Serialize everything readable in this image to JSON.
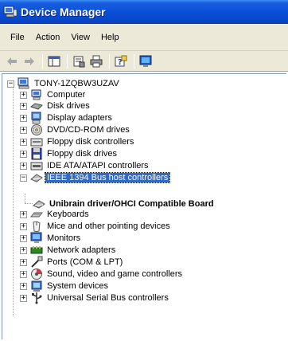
{
  "window": {
    "title": "Device Manager",
    "title_icon": "device-manager-icon"
  },
  "menu": [
    "File",
    "Action",
    "View",
    "Help"
  ],
  "toolbar": {
    "buttons": [
      "back-arrow-icon",
      "forward-arrow-icon",
      "show-hide-tree-icon",
      "properties-icon",
      "print-icon",
      "help-icon",
      "scan-hardware-icon"
    ]
  },
  "tree": {
    "root": "TONY-1ZQBW3UZAV",
    "categories": [
      {
        "label": "Computer",
        "icon": "computer-icon"
      },
      {
        "label": "Disk drives",
        "icon": "disk-drive-icon"
      },
      {
        "label": "Display adapters",
        "icon": "display-adapter-icon"
      },
      {
        "label": "DVD/CD-ROM drives",
        "icon": "cdrom-icon"
      },
      {
        "label": "Floppy disk controllers",
        "icon": "floppy-controller-icon"
      },
      {
        "label": "Floppy disk drives",
        "icon": "floppy-drive-icon"
      },
      {
        "label": "IDE ATA/ATAPI controllers",
        "icon": "ide-controller-icon"
      },
      {
        "label": "IEEE 1394 Bus host controllers",
        "icon": "ieee1394-icon",
        "expanded": true,
        "selected": true
      },
      {
        "label": "Keyboards",
        "icon": "keyboard-icon"
      },
      {
        "label": "Mice and other pointing devices",
        "icon": "mouse-icon"
      },
      {
        "label": "Monitors",
        "icon": "monitor-icon"
      },
      {
        "label": "Network adapters",
        "icon": "network-adapter-icon"
      },
      {
        "label": "Ports (COM & LPT)",
        "icon": "port-icon"
      },
      {
        "label": "Sound, video and game controllers",
        "icon": "sound-icon"
      },
      {
        "label": "System devices",
        "icon": "system-device-icon"
      },
      {
        "label": "Universal Serial Bus controllers",
        "icon": "usb-icon"
      }
    ],
    "child": "Unibrain driver/OHCI Compatible Board"
  },
  "colors": {
    "titlebar": "#0a50d8",
    "chrome": "#ece9d8",
    "selection": "#316ac5"
  }
}
